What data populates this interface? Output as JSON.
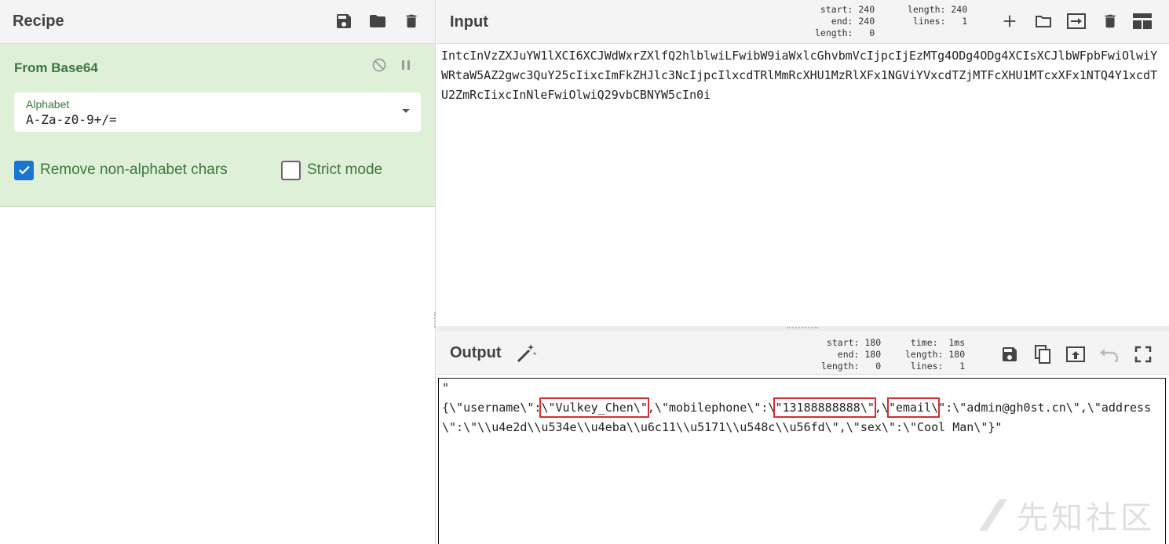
{
  "recipe": {
    "title": "Recipe",
    "icons": [
      "save-icon",
      "folder-icon",
      "trash-icon"
    ],
    "operation": {
      "name": "From Base64",
      "alphabet_label": "Alphabet",
      "alphabet_value": "A-Za-z0-9+/=",
      "remove_non_alphabet_label": "Remove non-alphabet chars",
      "remove_non_alphabet_checked": true,
      "strict_mode_label": "Strict mode",
      "strict_mode_checked": false
    }
  },
  "input": {
    "title": "Input",
    "stats_left": "start: 240\n  end: 240\nlength:   0",
    "stats_right": "length: 240\n lines:   1",
    "text": "IntcInVzZXJuYW1lXCI6XCJWdWxrZXlfQ2hlblwiLFwibW9iaWxlcGhvbmVcIjpcIjEzMTg4ODg4ODg4XCIsXCJlbWFpbFwiOlwiYWRtaW5AZ2gwc3QuY25cIixcImFkZHJlc3NcIjpcIlxcdTRlMmRcXHU1MzRlXFx1NGViYVxcdTZjMTFcXHU1MTcxXFx1NTQ4Y1xcdTU2ZmRcIixcInNleFwiOlwiQ29vbCBNYW5cIn0i"
  },
  "output": {
    "title": "Output",
    "stats_left": "start: 180\n  end: 180\nlength:   0",
    "stats_right": "time:  1ms\nlength: 180\n lines:   1",
    "line1": "\"",
    "seg1": "{\\\"username\\\":",
    "hl1": "\\\"Vulkey_Chen\\\"",
    "seg2": ",\\\"mobilephone\\\":\\",
    "hl2": "\"13188888888\\\"",
    "seg3": ",\\",
    "hl3": "\"email\\",
    "seg4": "\":\\\"admin@gh0st.cn\\\",\\\"address\\\":\\\"\\\\u4e2d\\\\u534e\\\\u4eba\\\\u6c11\\\\u5171\\\\u548c\\\\u56fd\\\",\\\"sex\\\":\\\"Cool Man\\\"}\""
  },
  "watermark": {
    "text": "先知社区"
  },
  "colors": {
    "op_bg": "#dff0d8",
    "op_text": "#3c763d",
    "checkbox_on": "#1976d2",
    "highlight": "#d32f2f"
  }
}
